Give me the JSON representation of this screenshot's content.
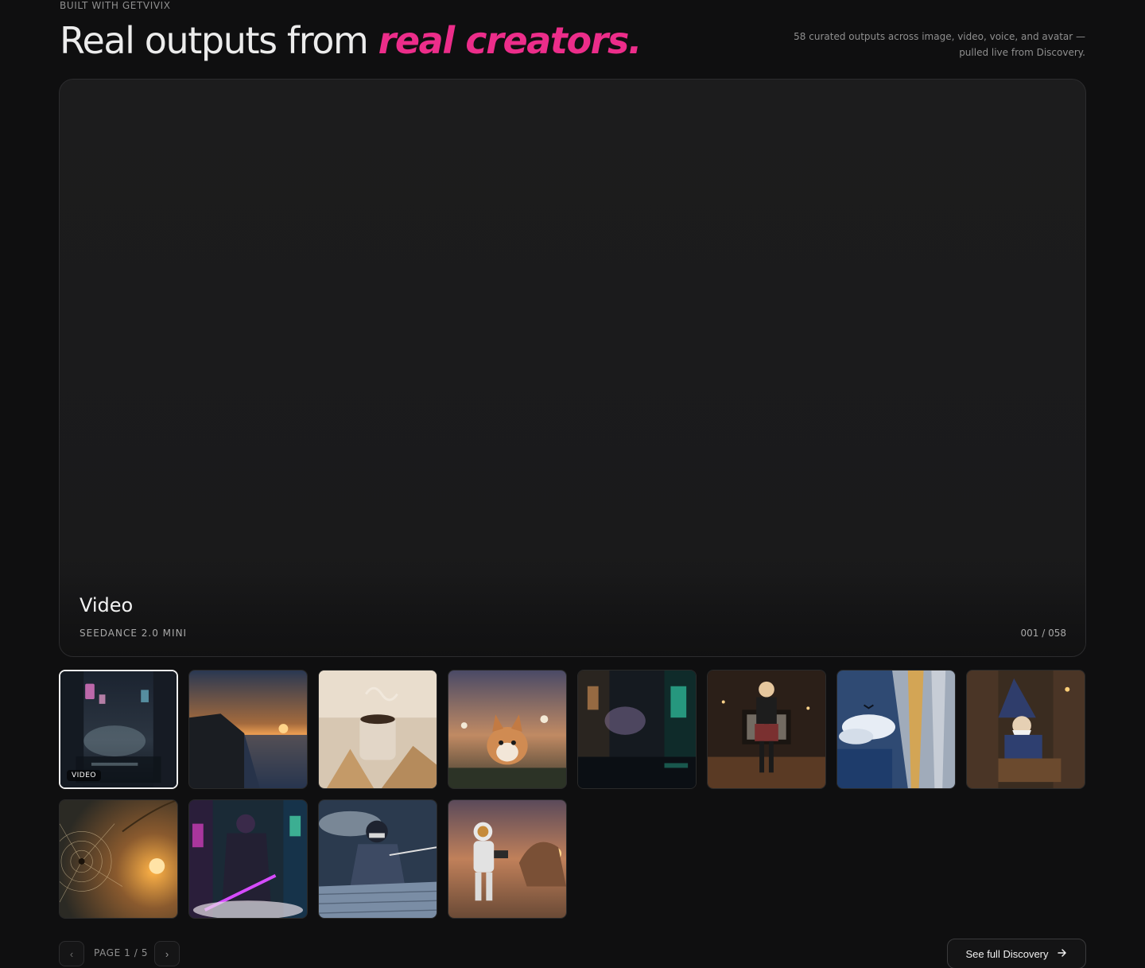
{
  "header": {
    "eyebrow": "BUILT WITH GETVIVIX",
    "headline_plain": "Real outputs from",
    "headline_accent": "real creators.",
    "intro_line1": "58 curated outputs across image, video, voice, and avatar —",
    "intro_line2": "pulled live from Discovery.",
    "accent_color": "#ec2d8a"
  },
  "stage": {
    "title": "Video",
    "model": "SEEDANCE 2.0 MINI",
    "counter": "001 / 058"
  },
  "gallery": {
    "selected_tag": "VIDEO",
    "thumbnails": [
      "neon-alley-rain",
      "sunset-sea-cliff",
      "hands-holding-coffee-mug",
      "corgi-in-flower-field",
      "rainy-neon-street",
      "woman-in-plaid-dress-room",
      "giant-curtain-over-clouds",
      "wizard-writing-in-library",
      "spider-web-at-sunset",
      "neon-samurai-city",
      "ninja-on-rooftop",
      "astronaut-in-desert"
    ]
  },
  "pagination": {
    "prev_icon": "chevron-left-icon",
    "next_icon": "chevron-right-icon",
    "page_label": "PAGE 1 / 5"
  },
  "cta": {
    "label": "See full Discovery",
    "icon": "arrow-right-icon"
  }
}
